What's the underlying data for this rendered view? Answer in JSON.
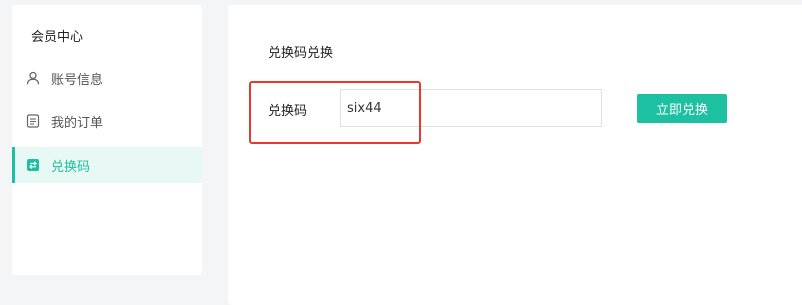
{
  "sidebar": {
    "title": "会员中心",
    "items": [
      {
        "label": "账号信息",
        "icon": "user-icon",
        "active": false
      },
      {
        "label": "我的订单",
        "icon": "document-icon",
        "active": false
      },
      {
        "label": "兑换码",
        "icon": "exchange-icon",
        "active": true
      }
    ]
  },
  "main": {
    "title": "兑换码兑换",
    "field_label": "兑换码",
    "input_value": "six44",
    "button_label": "立即兑换"
  },
  "colors": {
    "accent": "#1dc0a0",
    "active_bg": "#e8f8f4",
    "highlight": "#e8392c"
  }
}
